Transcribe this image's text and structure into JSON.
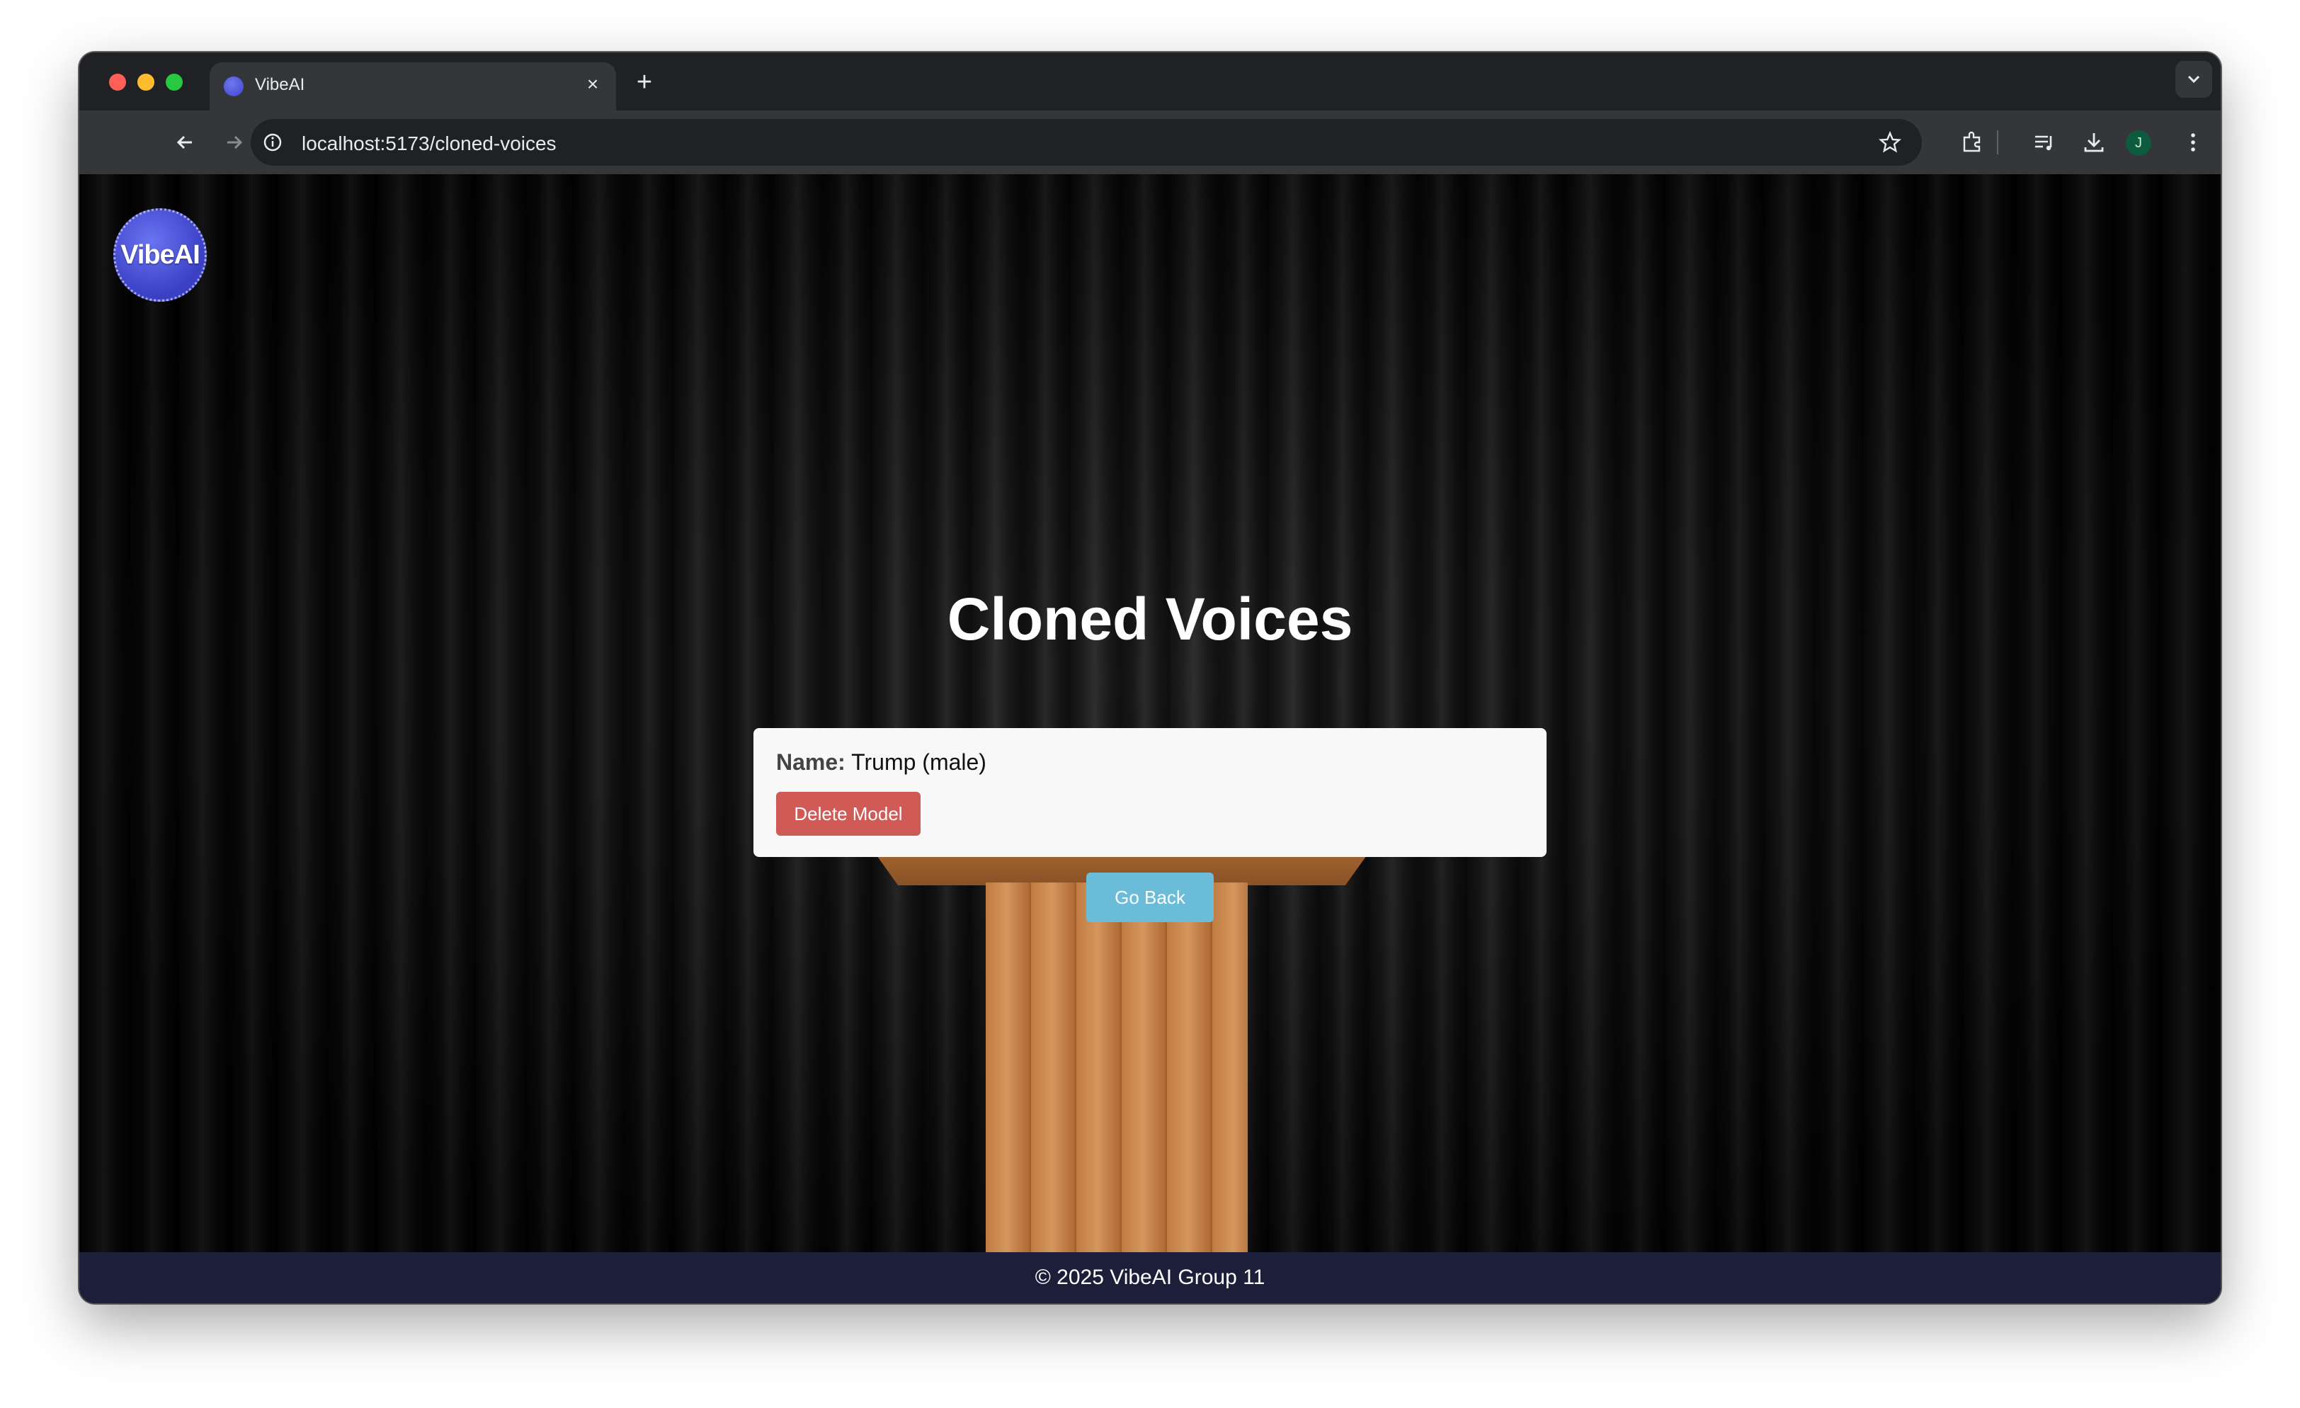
{
  "browser": {
    "tab": {
      "title": "VibeAI",
      "close_glyph": "×"
    },
    "new_tab_glyph": "+",
    "url": "localhost:5173/cloned-voices",
    "profile_initial": "J"
  },
  "page": {
    "logo_text": "VibeAI",
    "title": "Cloned Voices",
    "voices": [
      {
        "name_label": "Name:",
        "name_value": "Trump (male)",
        "delete_label": "Delete Model"
      }
    ],
    "go_back_label": "Go Back",
    "footer": "© 2025 VibeAI Group 11"
  },
  "colors": {
    "delete_button": "#d05a55",
    "go_back_button": "#6bbcd9",
    "footer_bg": "#1d1e3a",
    "logo": "#4a52d8"
  },
  "icons": [
    "back-icon",
    "forward-icon",
    "reload-icon",
    "info-icon",
    "star-icon",
    "extensions-icon",
    "reading-list-icon",
    "download-icon",
    "menu-icon",
    "tab-search-icon"
  ]
}
